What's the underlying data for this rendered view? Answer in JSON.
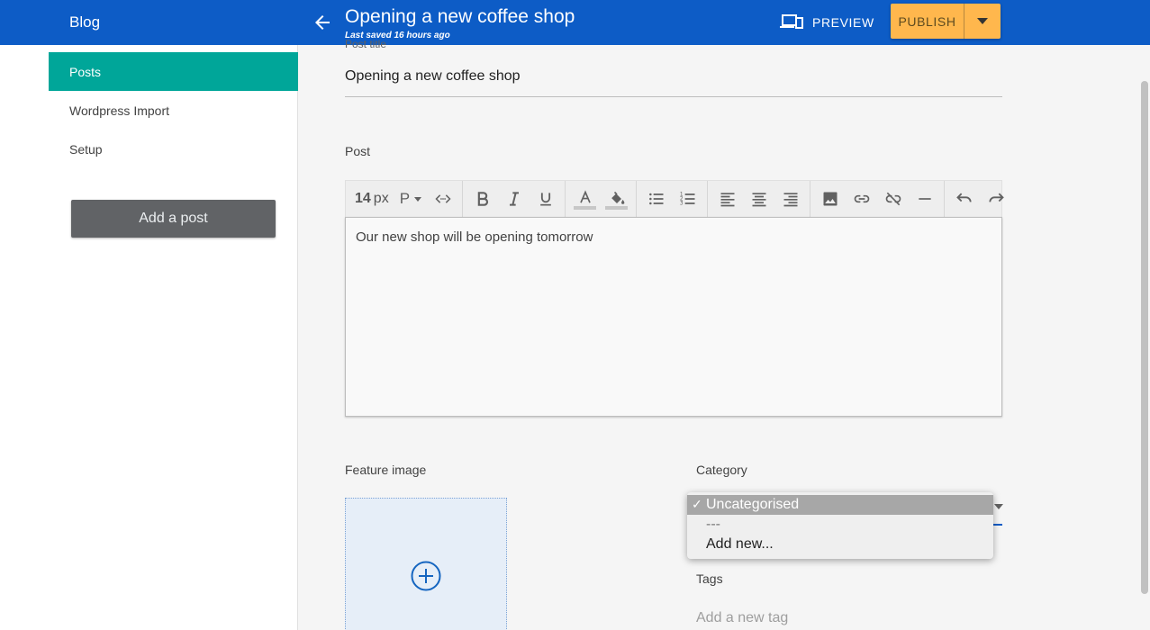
{
  "header": {
    "brand": "Blog",
    "post_title": "Opening a new coffee shop",
    "saved_status": "Last saved 16 hours ago",
    "preview_label": "PREVIEW",
    "publish_label": "PUBLISH"
  },
  "colors": {
    "header_bg": "#0d5cc6",
    "active_nav": "#00a699",
    "publish_bg": "#ffb74d",
    "add_post_bg": "#616366"
  },
  "sidebar": {
    "items": [
      {
        "label": "Posts",
        "active": true
      },
      {
        "label": "Wordpress Import",
        "active": false
      },
      {
        "label": "Setup",
        "active": false
      }
    ],
    "add_post_label": "Add a post"
  },
  "editor": {
    "title_field_label": "Post title",
    "title_value": "Opening a new coffee shop",
    "post_label": "Post",
    "font_size": "14",
    "font_size_unit": "px",
    "paragraph_style": "P",
    "body_text": "Our new shop will be opening tomorrow",
    "toolbar_icons": [
      "code-icon",
      "bold-icon",
      "italic-icon",
      "underline-icon",
      "text-color-icon",
      "fill-color-icon",
      "bullet-list-icon",
      "numbered-list-icon",
      "align-left-icon",
      "align-center-icon",
      "align-right-icon",
      "image-icon",
      "link-icon",
      "unlink-icon",
      "horizontal-rule-icon",
      "undo-icon",
      "redo-icon"
    ]
  },
  "feature_image": {
    "label": "Feature image"
  },
  "category": {
    "label": "Category",
    "options": [
      "Uncategorised",
      "---",
      "Add new..."
    ],
    "selected": "Uncategorised",
    "check": "✓"
  },
  "tags": {
    "label": "Tags",
    "placeholder": "Add a new tag"
  }
}
